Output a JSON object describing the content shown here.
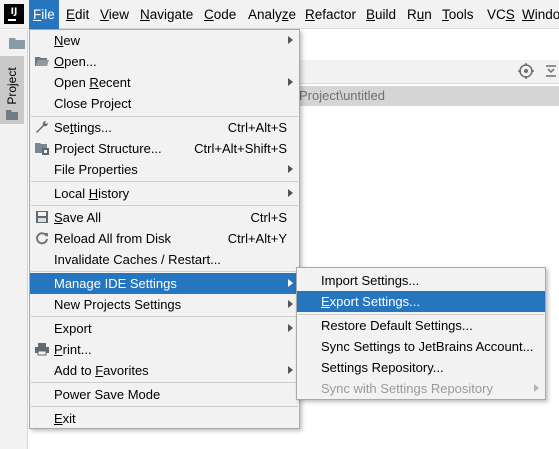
{
  "app": {
    "logo_text": "IJ"
  },
  "menubar": {
    "items": [
      {
        "label": "File",
        "mnemonic": "F",
        "rest": "ile"
      },
      {
        "label": "Edit",
        "mnemonic": "E",
        "rest": "dit"
      },
      {
        "label": "View",
        "mnemonic": "V",
        "rest": "iew"
      },
      {
        "label": "Navigate",
        "mnemonic": "N",
        "rest": "avigate"
      },
      {
        "label": "Code",
        "mnemonic": "C",
        "rest": "ode"
      },
      {
        "label": "Analyze",
        "pre": "Analy",
        "mnemonic": "z",
        "rest": "e"
      },
      {
        "label": "Refactor",
        "mnemonic": "R",
        "rest": "efactor"
      },
      {
        "label": "Build",
        "mnemonic": "B",
        "rest": "uild"
      },
      {
        "label": "Run",
        "pre": "R",
        "mnemonic": "u",
        "rest": "n"
      },
      {
        "label": "Tools",
        "mnemonic": "T",
        "rest": "ools"
      },
      {
        "label": "VCS",
        "pre": "VC",
        "mnemonic": "S",
        "rest": ""
      },
      {
        "label": "Window",
        "mnemonic": "W",
        "rest": "indo"
      }
    ]
  },
  "sidebar": {
    "project_tab_label": "Project"
  },
  "editor": {
    "path_text": "Project\\untitled"
  },
  "file_menu": {
    "new": {
      "label": "New",
      "pre": "",
      "mnemonic": "N",
      "rest": "ew"
    },
    "open": {
      "label": "Open...",
      "pre": "",
      "mnemonic": "O",
      "rest": "pen..."
    },
    "open_recent": {
      "label": "Open Recent",
      "pre": "Open ",
      "mnemonic": "R",
      "rest": "ecent"
    },
    "close_project": {
      "label": "Close Project"
    },
    "settings": {
      "label": "Settings...",
      "pre": "Se",
      "mnemonic": "t",
      "rest": "tings...",
      "shortcut": "Ctrl+Alt+S"
    },
    "project_structure": {
      "label": "Project Structure...",
      "shortcut": "Ctrl+Alt+Shift+S"
    },
    "file_properties": {
      "label": "File Properties"
    },
    "local_history": {
      "label": "Local History",
      "pre": "Local ",
      "mnemonic": "H",
      "rest": "istory"
    },
    "save_all": {
      "label": "Save All",
      "pre": "",
      "mnemonic": "S",
      "rest": "ave All",
      "shortcut": "Ctrl+S"
    },
    "reload": {
      "label": "Reload All from Disk",
      "shortcut": "Ctrl+Alt+Y"
    },
    "invalidate": {
      "label": "Invalidate Caches / Restart..."
    },
    "manage_ide": {
      "label": "Manage IDE Settings"
    },
    "new_projects_settings": {
      "label": "New Projects Settings"
    },
    "export": {
      "label": "Export"
    },
    "print": {
      "label": "Print...",
      "pre": "",
      "mnemonic": "P",
      "rest": "rint..."
    },
    "add_favorites": {
      "label": "Add to Favorites",
      "pre": "Add to ",
      "mnemonic": "F",
      "rest": "avorites"
    },
    "power_save": {
      "label": "Power Save Mode"
    },
    "exit": {
      "label": "Exit",
      "pre": "",
      "mnemonic": "E",
      "rest": "xit"
    }
  },
  "sub_menu": {
    "import": {
      "label": "Import Settings..."
    },
    "export": {
      "label": "Export Settings...",
      "pre": "",
      "mnemonic": "E",
      "rest": "xport Settings..."
    },
    "restore": {
      "label": "Restore Default Settings..."
    },
    "sync_jb": {
      "label": "Sync Settings to JetBrains Account..."
    },
    "repository": {
      "label": "Settings Repository..."
    },
    "sync_repo": {
      "label": "Sync with Settings Repository"
    }
  },
  "colors": {
    "highlight": "#2675bf",
    "menu_bg": "#f2f2f2",
    "disabled_text": "#9a9a9a"
  }
}
